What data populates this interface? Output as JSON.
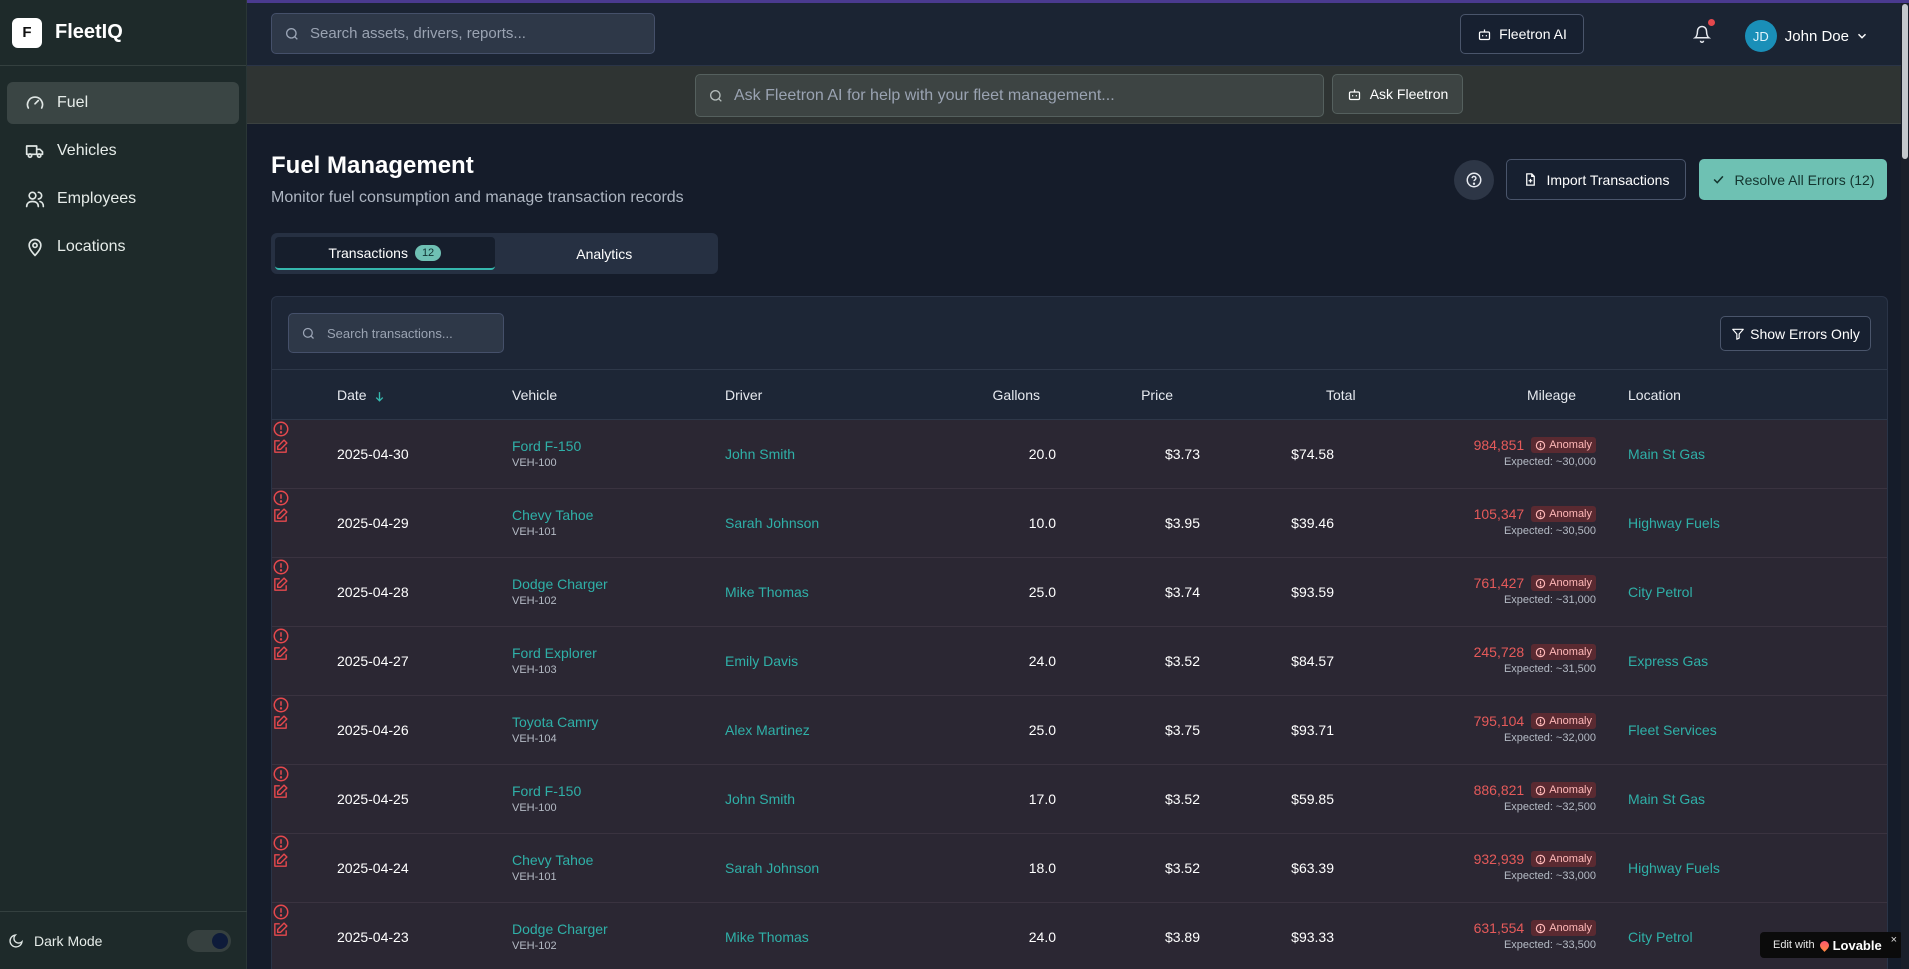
{
  "app": {
    "logo_letter": "F",
    "name": "FleetIQ"
  },
  "sidebar": {
    "items": [
      {
        "label": "Fuel",
        "icon": "gauge-icon",
        "active": true
      },
      {
        "label": "Vehicles",
        "icon": "truck-icon"
      },
      {
        "label": "Employees",
        "icon": "users-icon"
      },
      {
        "label": "Locations",
        "icon": "map-pin-icon"
      }
    ],
    "footer": {
      "label": "Dark Mode",
      "icon": "moon-icon",
      "enabled": true
    }
  },
  "topbar": {
    "search_placeholder": "Search assets, drivers, reports...",
    "ai_button": "Fleetron AI",
    "has_notifications": true,
    "user": {
      "initials": "JD",
      "name": "John Doe"
    }
  },
  "aibar": {
    "placeholder": "Ask Fleetron AI for help with your fleet management...",
    "button": "Ask Fleetron"
  },
  "page": {
    "title": "Fuel Management",
    "subtitle": "Monitor fuel consumption and manage transaction records",
    "import_button": "Import Transactions",
    "resolve_button": "Resolve All Errors (12)",
    "tabs": [
      {
        "label": "Transactions",
        "badge": "12",
        "active": true
      },
      {
        "label": "Analytics"
      }
    ]
  },
  "table": {
    "search_placeholder": "Search transactions...",
    "filter_button": "Show Errors Only",
    "columns": [
      "Date",
      "Vehicle",
      "Driver",
      "Gallons",
      "Price",
      "Total",
      "Mileage",
      "Location"
    ],
    "rows": [
      {
        "date": "2025-04-30",
        "vehicle": "Ford F-150",
        "vehicle_id": "VEH-100",
        "driver": "John Smith",
        "gallons": "20.0",
        "price": "$3.73",
        "total": "$74.58",
        "mileage": "984,851",
        "badge": "Anomaly",
        "expected": "Expected: ~30,000",
        "location": "Main St Gas"
      },
      {
        "date": "2025-04-29",
        "vehicle": "Chevy Tahoe",
        "vehicle_id": "VEH-101",
        "driver": "Sarah Johnson",
        "gallons": "10.0",
        "price": "$3.95",
        "total": "$39.46",
        "mileage": "105,347",
        "badge": "Anomaly",
        "expected": "Expected: ~30,500",
        "location": "Highway Fuels"
      },
      {
        "date": "2025-04-28",
        "vehicle": "Dodge Charger",
        "vehicle_id": "VEH-102",
        "driver": "Mike Thomas",
        "gallons": "25.0",
        "price": "$3.74",
        "total": "$93.59",
        "mileage": "761,427",
        "badge": "Anomaly",
        "expected": "Expected: ~31,000",
        "location": "City Petrol"
      },
      {
        "date": "2025-04-27",
        "vehicle": "Ford Explorer",
        "vehicle_id": "VEH-103",
        "driver": "Emily Davis",
        "gallons": "24.0",
        "price": "$3.52",
        "total": "$84.57",
        "mileage": "245,728",
        "badge": "Anomaly",
        "expected": "Expected: ~31,500",
        "location": "Express Gas"
      },
      {
        "date": "2025-04-26",
        "vehicle": "Toyota Camry",
        "vehicle_id": "VEH-104",
        "driver": "Alex Martinez",
        "gallons": "25.0",
        "price": "$3.75",
        "total": "$93.71",
        "mileage": "795,104",
        "badge": "Anomaly",
        "expected": "Expected: ~32,000",
        "location": "Fleet Services"
      },
      {
        "date": "2025-04-25",
        "vehicle": "Ford F-150",
        "vehicle_id": "VEH-100",
        "driver": "John Smith",
        "gallons": "17.0",
        "price": "$3.52",
        "total": "$59.85",
        "mileage": "886,821",
        "badge": "Anomaly",
        "expected": "Expected: ~32,500",
        "location": "Main St Gas"
      },
      {
        "date": "2025-04-24",
        "vehicle": "Chevy Tahoe",
        "vehicle_id": "VEH-101",
        "driver": "Sarah Johnson",
        "gallons": "18.0",
        "price": "$3.52",
        "total": "$63.39",
        "mileage": "932,939",
        "badge": "Anomaly",
        "expected": "Expected: ~33,000",
        "location": "Highway Fuels"
      },
      {
        "date": "2025-04-23",
        "vehicle": "Dodge Charger",
        "vehicle_id": "VEH-102",
        "driver": "Mike Thomas",
        "gallons": "24.0",
        "price": "$3.89",
        "total": "$93.33",
        "mileage": "631,554",
        "badge": "Anomaly",
        "expected": "Expected: ~33,500",
        "location": "City Petrol"
      }
    ]
  },
  "lovable": {
    "prefix": "Edit with",
    "brand": "Lovable",
    "close": "×"
  },
  "colors": {
    "accent": "#35b7ad",
    "error": "#e5484d",
    "resolve_button": "#6ec1b3"
  }
}
